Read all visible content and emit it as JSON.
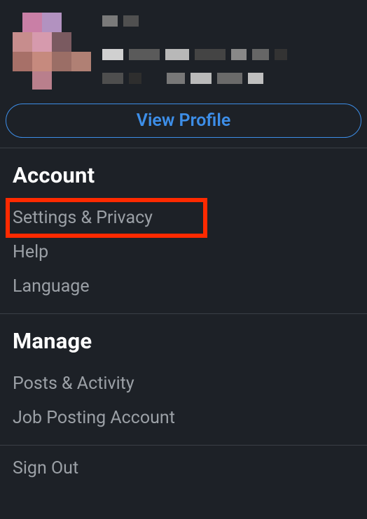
{
  "profile": {
    "view_profile_label": "View Profile"
  },
  "account": {
    "heading": "Account",
    "items": [
      {
        "label": "Settings & Privacy"
      },
      {
        "label": "Help"
      },
      {
        "label": "Language"
      }
    ]
  },
  "manage": {
    "heading": "Manage",
    "items": [
      {
        "label": "Posts & Activity"
      },
      {
        "label": "Job Posting Account"
      }
    ]
  },
  "signout": {
    "label": "Sign Out"
  },
  "colors": {
    "accent": "#3d8ee8",
    "highlight_box": "#ff2a00",
    "bg": "#1d2127"
  }
}
